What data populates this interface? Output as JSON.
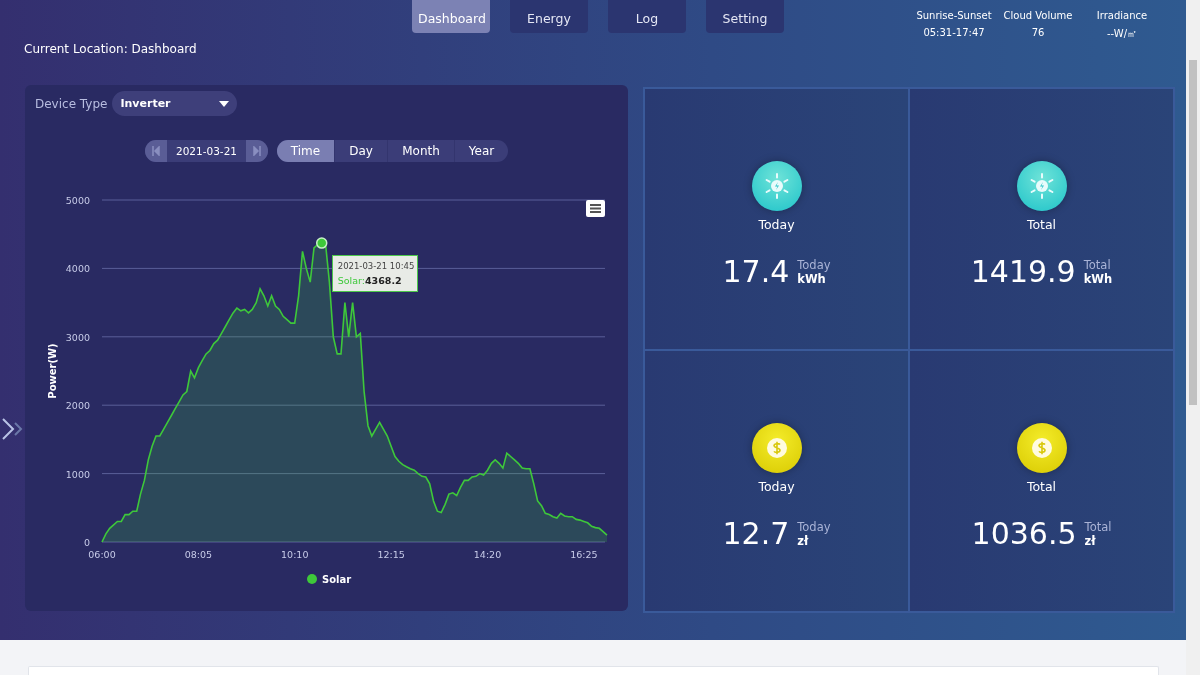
{
  "nav_tabs": [
    {
      "label": "Dashboard",
      "selected": true
    },
    {
      "label": "Energy",
      "selected": false
    },
    {
      "label": "Log",
      "selected": false
    },
    {
      "label": "Setting",
      "selected": false
    }
  ],
  "location": "Current Location: Dashboard",
  "weather": [
    {
      "label": "Sunrise-Sunset",
      "value": "05:31-17:47"
    },
    {
      "label": "Cloud Volume",
      "value": "76"
    },
    {
      "label": "Irradiance",
      "value": "--W/㎡"
    }
  ],
  "device_type": {
    "label": "Device Type",
    "value": "Inverter"
  },
  "date_picker": {
    "value": "2021-03-21"
  },
  "period_tabs": [
    {
      "label": "Time",
      "selected": true
    },
    {
      "label": "Day",
      "selected": false
    },
    {
      "label": "Month",
      "selected": false
    },
    {
      "label": "Year",
      "selected": false
    }
  ],
  "chart": {
    "tooltip": {
      "title": "2021-03-21 10:45",
      "series_label": "Solar:",
      "value": "4368.2"
    },
    "chart_data": {
      "type": "area",
      "ylabel": "Power(W)",
      "grid": true,
      "categories": [
        "06:00",
        null,
        null,
        null,
        null,
        null,
        null,
        null,
        null,
        null,
        null,
        null,
        null,
        null,
        null,
        null,
        null,
        null,
        null,
        null,
        null,
        null,
        null,
        null,
        null,
        "08:05",
        null,
        null,
        null,
        null,
        null,
        null,
        null,
        null,
        null,
        null,
        null,
        null,
        null,
        null,
        null,
        null,
        null,
        null,
        null,
        null,
        null,
        null,
        null,
        null,
        "10:10",
        null,
        null,
        null,
        null,
        null,
        null,
        null,
        null,
        null,
        null,
        null,
        null,
        null,
        null,
        null,
        null,
        null,
        null,
        null,
        null,
        null,
        null,
        null,
        null,
        "12:15",
        null,
        null,
        null,
        null,
        null,
        null,
        null,
        null,
        null,
        null,
        null,
        null,
        null,
        null,
        null,
        null,
        null,
        null,
        null,
        null,
        null,
        null,
        null,
        null,
        "14:20",
        null,
        null,
        null,
        null,
        null,
        null,
        null,
        null,
        null,
        null,
        null,
        null,
        null,
        null,
        null,
        null,
        null,
        null,
        null,
        null,
        null,
        null,
        null,
        null,
        "16:25",
        null,
        null,
        null,
        null,
        null,
        null
      ],
      "series": [
        {
          "name": "Solar",
          "color": "#3ec83a",
          "values": [
            0,
            120,
            200,
            250,
            300,
            300,
            400,
            400,
            450,
            450,
            700,
            900,
            1200,
            1400,
            1550,
            1550,
            1650,
            1750,
            1850,
            1950,
            2050,
            2150,
            2200,
            2500,
            2400,
            2550,
            2650,
            2750,
            2800,
            2900,
            2950,
            3050,
            3150,
            3250,
            3350,
            3420,
            3380,
            3400,
            3350,
            3400,
            3500,
            3700,
            3600,
            3450,
            3600,
            3450,
            3400,
            3300,
            3250,
            3200,
            3200,
            3600,
            4250,
            4000,
            3800,
            4300,
            4350,
            4370,
            4350,
            3800,
            3000,
            2750,
            2750,
            3500,
            3000,
            3500,
            3000,
            3050,
            2200,
            1700,
            1550,
            1650,
            1750,
            1650,
            1550,
            1400,
            1250,
            1180,
            1130,
            1100,
            1070,
            1050,
            1000,
            960,
            950,
            850,
            600,
            450,
            430,
            550,
            700,
            720,
            680,
            800,
            900,
            900,
            950,
            960,
            1000,
            980,
            1050,
            1150,
            1200,
            1150,
            1080,
            1300,
            1250,
            1200,
            1150,
            1080,
            1070,
            1070,
            850,
            600,
            530,
            420,
            400,
            370,
            350,
            420,
            380,
            370,
            370,
            330,
            320,
            300,
            280,
            230,
            210,
            200,
            150,
            100
          ]
        }
      ],
      "ylim": [
        0,
        5000
      ],
      "yticks": [
        0,
        1000,
        2000,
        3000,
        4000,
        5000
      ]
    }
  },
  "stats": [
    {
      "kind": "energy",
      "label": "Today",
      "value": "17.4",
      "sub_label": "Today",
      "unit": "kWh"
    },
    {
      "kind": "energy",
      "label": "Total",
      "value": "1419.9",
      "sub_label": "Total",
      "unit": "kWh"
    },
    {
      "kind": "money",
      "label": "Today",
      "value": "12.7",
      "sub_label": "Today",
      "unit": "zł"
    },
    {
      "kind": "money",
      "label": "Total",
      "value": "1036.5",
      "sub_label": "Total",
      "unit": "zł"
    }
  ]
}
